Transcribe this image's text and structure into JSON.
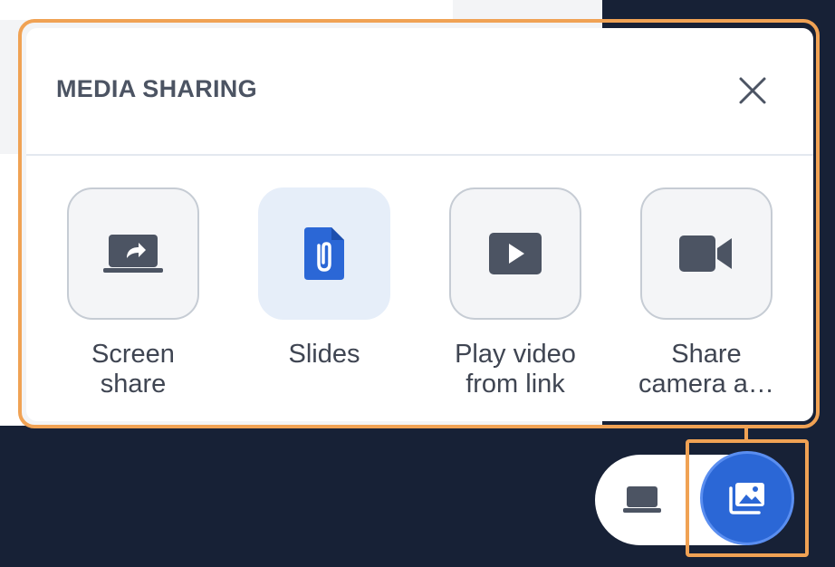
{
  "panel": {
    "title": "MEDIA SHARING",
    "close_icon": "close-icon"
  },
  "options": [
    {
      "line1": "Screen",
      "line2": "share",
      "icon": "screen-share-icon",
      "selected": false
    },
    {
      "line1": "Slides",
      "line2": "",
      "icon": "slides-file-icon",
      "selected": true
    },
    {
      "line1": "Play video",
      "line2": "from link",
      "icon": "play-video-icon",
      "selected": false
    },
    {
      "line1": "Share",
      "line2": "camera a…",
      "icon": "video-camera-icon",
      "selected": false
    }
  ],
  "dock": {
    "device_icon": "laptop-icon",
    "media_icon": "media-gallery-icon"
  },
  "colors": {
    "accent": "#2b67d6",
    "highlight": "#f0a254",
    "background": "#172136"
  }
}
